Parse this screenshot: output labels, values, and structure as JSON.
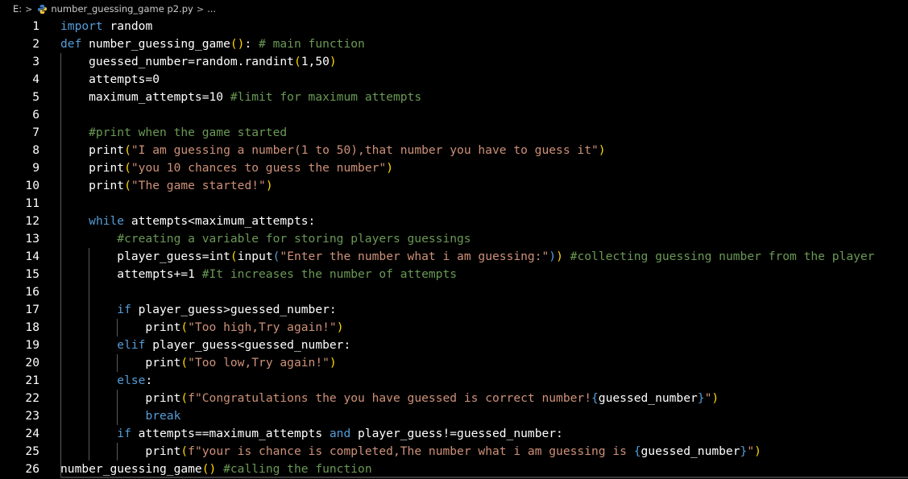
{
  "breadcrumb": {
    "drive": "E:",
    "sep1": ">",
    "file": "number_guessing_game p2.py",
    "sep2": ">",
    "more": "..."
  },
  "colors": {
    "keyword": "#569cd6",
    "text": "#ffffff",
    "comment": "#6a9955",
    "string": "#ce9178",
    "number": "#b5cea8",
    "function": "#dcdcaa",
    "bracket": "#ffd700",
    "fstring_bracket": "#569cd6",
    "line_number": "#ffffff"
  },
  "lines": [
    {
      "n": "1",
      "tokens": [
        {
          "t": "import",
          "c": "keyword"
        },
        {
          "t": " ",
          "c": "text"
        },
        {
          "t": "random",
          "c": "text"
        }
      ]
    },
    {
      "n": "2",
      "tokens": [
        {
          "t": "def",
          "c": "keyword"
        },
        {
          "t": " number_guessing_game",
          "c": "text"
        },
        {
          "t": "()",
          "c": "bracket"
        },
        {
          "t": ":",
          "c": "text"
        },
        {
          "t": " # main function",
          "c": "comment"
        }
      ]
    },
    {
      "n": "3",
      "tokens": [
        {
          "t": "    guessed_number=random.randint",
          "c": "text"
        },
        {
          "t": "(",
          "c": "bracket"
        },
        {
          "t": "1,50",
          "c": "text"
        },
        {
          "t": ")",
          "c": "bracket"
        }
      ]
    },
    {
      "n": "4",
      "tokens": [
        {
          "t": "    attempts=0",
          "c": "text"
        }
      ]
    },
    {
      "n": "5",
      "tokens": [
        {
          "t": "    maximum_attempts=10",
          "c": "text"
        },
        {
          "t": " #limit for maximum attempts",
          "c": "comment"
        }
      ]
    },
    {
      "n": "6",
      "tokens": []
    },
    {
      "n": "7",
      "tokens": [
        {
          "t": "    #print when the game started",
          "c": "comment"
        }
      ]
    },
    {
      "n": "8",
      "tokens": [
        {
          "t": "    print",
          "c": "text"
        },
        {
          "t": "(",
          "c": "bracket"
        },
        {
          "t": "\"I am guessing a number(1 to 50),that number you have to guess it\"",
          "c": "string"
        },
        {
          "t": ")",
          "c": "bracket"
        }
      ]
    },
    {
      "n": "9",
      "tokens": [
        {
          "t": "    print",
          "c": "text"
        },
        {
          "t": "(",
          "c": "bracket"
        },
        {
          "t": "\"you 10 chances to guess the number\"",
          "c": "string"
        },
        {
          "t": ")",
          "c": "bracket"
        }
      ]
    },
    {
      "n": "10",
      "tokens": [
        {
          "t": "    print",
          "c": "text"
        },
        {
          "t": "(",
          "c": "bracket"
        },
        {
          "t": "\"The game started!\"",
          "c": "string"
        },
        {
          "t": ")",
          "c": "bracket"
        }
      ]
    },
    {
      "n": "11",
      "tokens": []
    },
    {
      "n": "12",
      "tokens": [
        {
          "t": "    ",
          "c": "text"
        },
        {
          "t": "while",
          "c": "keyword"
        },
        {
          "t": " attempts<maximum_attempts:",
          "c": "text"
        }
      ]
    },
    {
      "n": "13",
      "tokens": [
        {
          "t": "        #creating a variable for storing players guessings",
          "c": "comment"
        }
      ]
    },
    {
      "n": "14",
      "tokens": [
        {
          "t": "        player_guess=int",
          "c": "text"
        },
        {
          "t": "(",
          "c": "bracket"
        },
        {
          "t": "input",
          "c": "text"
        },
        {
          "t": "(",
          "c": "fstring_bracket"
        },
        {
          "t": "\"Enter the number what i am guessing:\"",
          "c": "string"
        },
        {
          "t": ")",
          "c": "fstring_bracket"
        },
        {
          "t": ")",
          "c": "bracket"
        },
        {
          "t": " #collecting guessing number from the player",
          "c": "comment"
        }
      ]
    },
    {
      "n": "15",
      "tokens": [
        {
          "t": "        attempts+=1",
          "c": "text"
        },
        {
          "t": " #It increases the number of attempts",
          "c": "comment"
        }
      ]
    },
    {
      "n": "16",
      "tokens": []
    },
    {
      "n": "17",
      "tokens": [
        {
          "t": "        ",
          "c": "text"
        },
        {
          "t": "if",
          "c": "keyword"
        },
        {
          "t": " player_guess>guessed_number:",
          "c": "text"
        }
      ]
    },
    {
      "n": "18",
      "tokens": [
        {
          "t": "            print",
          "c": "text"
        },
        {
          "t": "(",
          "c": "bracket"
        },
        {
          "t": "\"Too high,Try again!\"",
          "c": "string"
        },
        {
          "t": ")",
          "c": "bracket"
        }
      ]
    },
    {
      "n": "19",
      "tokens": [
        {
          "t": "        ",
          "c": "text"
        },
        {
          "t": "elif",
          "c": "keyword"
        },
        {
          "t": " player_guess<guessed_number:",
          "c": "text"
        }
      ]
    },
    {
      "n": "20",
      "tokens": [
        {
          "t": "            print",
          "c": "text"
        },
        {
          "t": "(",
          "c": "bracket"
        },
        {
          "t": "\"Too low,Try again!\"",
          "c": "string"
        },
        {
          "t": ")",
          "c": "bracket"
        }
      ]
    },
    {
      "n": "21",
      "tokens": [
        {
          "t": "        ",
          "c": "text"
        },
        {
          "t": "else",
          "c": "keyword"
        },
        {
          "t": ":",
          "c": "text"
        }
      ]
    },
    {
      "n": "22",
      "tokens": [
        {
          "t": "            print",
          "c": "text"
        },
        {
          "t": "(",
          "c": "bracket"
        },
        {
          "t": "f\"Congratulations the you have guessed is correct number!",
          "c": "string"
        },
        {
          "t": "{",
          "c": "fstring_bracket"
        },
        {
          "t": "guessed_number",
          "c": "text"
        },
        {
          "t": "}",
          "c": "fstring_bracket"
        },
        {
          "t": "\"",
          "c": "string"
        },
        {
          "t": ")",
          "c": "bracket"
        }
      ]
    },
    {
      "n": "23",
      "tokens": [
        {
          "t": "            ",
          "c": "text"
        },
        {
          "t": "break",
          "c": "keyword"
        }
      ]
    },
    {
      "n": "24",
      "tokens": [
        {
          "t": "        ",
          "c": "text"
        },
        {
          "t": "if",
          "c": "keyword"
        },
        {
          "t": " attempts==maximum_attempts ",
          "c": "text"
        },
        {
          "t": "and",
          "c": "keyword"
        },
        {
          "t": " player_guess!=guessed_number:",
          "c": "text"
        }
      ]
    },
    {
      "n": "25",
      "tokens": [
        {
          "t": "            print",
          "c": "text"
        },
        {
          "t": "(",
          "c": "bracket"
        },
        {
          "t": "f\"your is chance is completed,The number what i am guessing is ",
          "c": "string"
        },
        {
          "t": "{",
          "c": "fstring_bracket"
        },
        {
          "t": "guessed_number",
          "c": "text"
        },
        {
          "t": "}",
          "c": "fstring_bracket"
        },
        {
          "t": "\"",
          "c": "string"
        },
        {
          "t": ")",
          "c": "bracket"
        }
      ]
    },
    {
      "n": "26",
      "tokens": [
        {
          "t": "number_guessing_game",
          "c": "text"
        },
        {
          "t": "()",
          "c": "bracket"
        },
        {
          "t": " #calling the function",
          "c": "comment"
        }
      ]
    }
  ]
}
